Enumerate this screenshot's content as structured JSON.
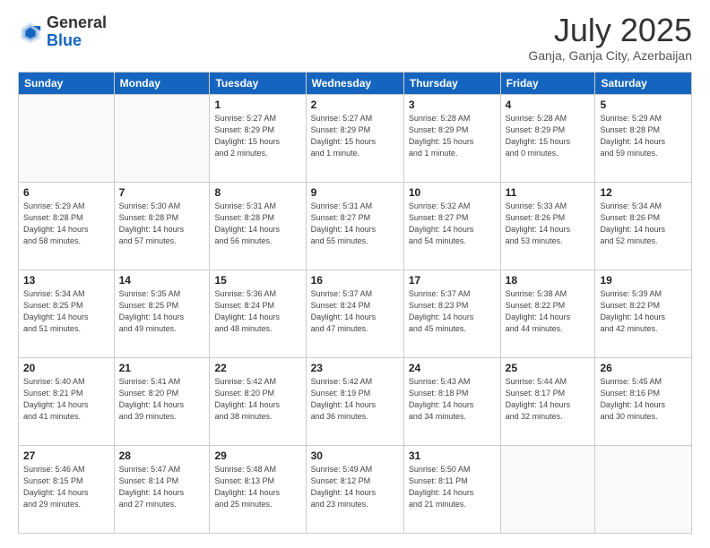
{
  "logo": {
    "general": "General",
    "blue": "Blue"
  },
  "header": {
    "month": "July 2025",
    "location": "Ganja, Ganja City, Azerbaijan"
  },
  "days_of_week": [
    "Sunday",
    "Monday",
    "Tuesday",
    "Wednesday",
    "Thursday",
    "Friday",
    "Saturday"
  ],
  "weeks": [
    [
      {
        "day": "",
        "info": ""
      },
      {
        "day": "",
        "info": ""
      },
      {
        "day": "1",
        "info": "Sunrise: 5:27 AM\nSunset: 8:29 PM\nDaylight: 15 hours\nand 2 minutes."
      },
      {
        "day": "2",
        "info": "Sunrise: 5:27 AM\nSunset: 8:29 PM\nDaylight: 15 hours\nand 1 minute."
      },
      {
        "day": "3",
        "info": "Sunrise: 5:28 AM\nSunset: 8:29 PM\nDaylight: 15 hours\nand 1 minute."
      },
      {
        "day": "4",
        "info": "Sunrise: 5:28 AM\nSunset: 8:29 PM\nDaylight: 15 hours\nand 0 minutes."
      },
      {
        "day": "5",
        "info": "Sunrise: 5:29 AM\nSunset: 8:28 PM\nDaylight: 14 hours\nand 59 minutes."
      }
    ],
    [
      {
        "day": "6",
        "info": "Sunrise: 5:29 AM\nSunset: 8:28 PM\nDaylight: 14 hours\nand 58 minutes."
      },
      {
        "day": "7",
        "info": "Sunrise: 5:30 AM\nSunset: 8:28 PM\nDaylight: 14 hours\nand 57 minutes."
      },
      {
        "day": "8",
        "info": "Sunrise: 5:31 AM\nSunset: 8:28 PM\nDaylight: 14 hours\nand 56 minutes."
      },
      {
        "day": "9",
        "info": "Sunrise: 5:31 AM\nSunset: 8:27 PM\nDaylight: 14 hours\nand 55 minutes."
      },
      {
        "day": "10",
        "info": "Sunrise: 5:32 AM\nSunset: 8:27 PM\nDaylight: 14 hours\nand 54 minutes."
      },
      {
        "day": "11",
        "info": "Sunrise: 5:33 AM\nSunset: 8:26 PM\nDaylight: 14 hours\nand 53 minutes."
      },
      {
        "day": "12",
        "info": "Sunrise: 5:34 AM\nSunset: 8:26 PM\nDaylight: 14 hours\nand 52 minutes."
      }
    ],
    [
      {
        "day": "13",
        "info": "Sunrise: 5:34 AM\nSunset: 8:25 PM\nDaylight: 14 hours\nand 51 minutes."
      },
      {
        "day": "14",
        "info": "Sunrise: 5:35 AM\nSunset: 8:25 PM\nDaylight: 14 hours\nand 49 minutes."
      },
      {
        "day": "15",
        "info": "Sunrise: 5:36 AM\nSunset: 8:24 PM\nDaylight: 14 hours\nand 48 minutes."
      },
      {
        "day": "16",
        "info": "Sunrise: 5:37 AM\nSunset: 8:24 PM\nDaylight: 14 hours\nand 47 minutes."
      },
      {
        "day": "17",
        "info": "Sunrise: 5:37 AM\nSunset: 8:23 PM\nDaylight: 14 hours\nand 45 minutes."
      },
      {
        "day": "18",
        "info": "Sunrise: 5:38 AM\nSunset: 8:22 PM\nDaylight: 14 hours\nand 44 minutes."
      },
      {
        "day": "19",
        "info": "Sunrise: 5:39 AM\nSunset: 8:22 PM\nDaylight: 14 hours\nand 42 minutes."
      }
    ],
    [
      {
        "day": "20",
        "info": "Sunrise: 5:40 AM\nSunset: 8:21 PM\nDaylight: 14 hours\nand 41 minutes."
      },
      {
        "day": "21",
        "info": "Sunrise: 5:41 AM\nSunset: 8:20 PM\nDaylight: 14 hours\nand 39 minutes."
      },
      {
        "day": "22",
        "info": "Sunrise: 5:42 AM\nSunset: 8:20 PM\nDaylight: 14 hours\nand 38 minutes."
      },
      {
        "day": "23",
        "info": "Sunrise: 5:42 AM\nSunset: 8:19 PM\nDaylight: 14 hours\nand 36 minutes."
      },
      {
        "day": "24",
        "info": "Sunrise: 5:43 AM\nSunset: 8:18 PM\nDaylight: 14 hours\nand 34 minutes."
      },
      {
        "day": "25",
        "info": "Sunrise: 5:44 AM\nSunset: 8:17 PM\nDaylight: 14 hours\nand 32 minutes."
      },
      {
        "day": "26",
        "info": "Sunrise: 5:45 AM\nSunset: 8:16 PM\nDaylight: 14 hours\nand 30 minutes."
      }
    ],
    [
      {
        "day": "27",
        "info": "Sunrise: 5:46 AM\nSunset: 8:15 PM\nDaylight: 14 hours\nand 29 minutes."
      },
      {
        "day": "28",
        "info": "Sunrise: 5:47 AM\nSunset: 8:14 PM\nDaylight: 14 hours\nand 27 minutes."
      },
      {
        "day": "29",
        "info": "Sunrise: 5:48 AM\nSunset: 8:13 PM\nDaylight: 14 hours\nand 25 minutes."
      },
      {
        "day": "30",
        "info": "Sunrise: 5:49 AM\nSunset: 8:12 PM\nDaylight: 14 hours\nand 23 minutes."
      },
      {
        "day": "31",
        "info": "Sunrise: 5:50 AM\nSunset: 8:11 PM\nDaylight: 14 hours\nand 21 minutes."
      },
      {
        "day": "",
        "info": ""
      },
      {
        "day": "",
        "info": ""
      }
    ]
  ]
}
